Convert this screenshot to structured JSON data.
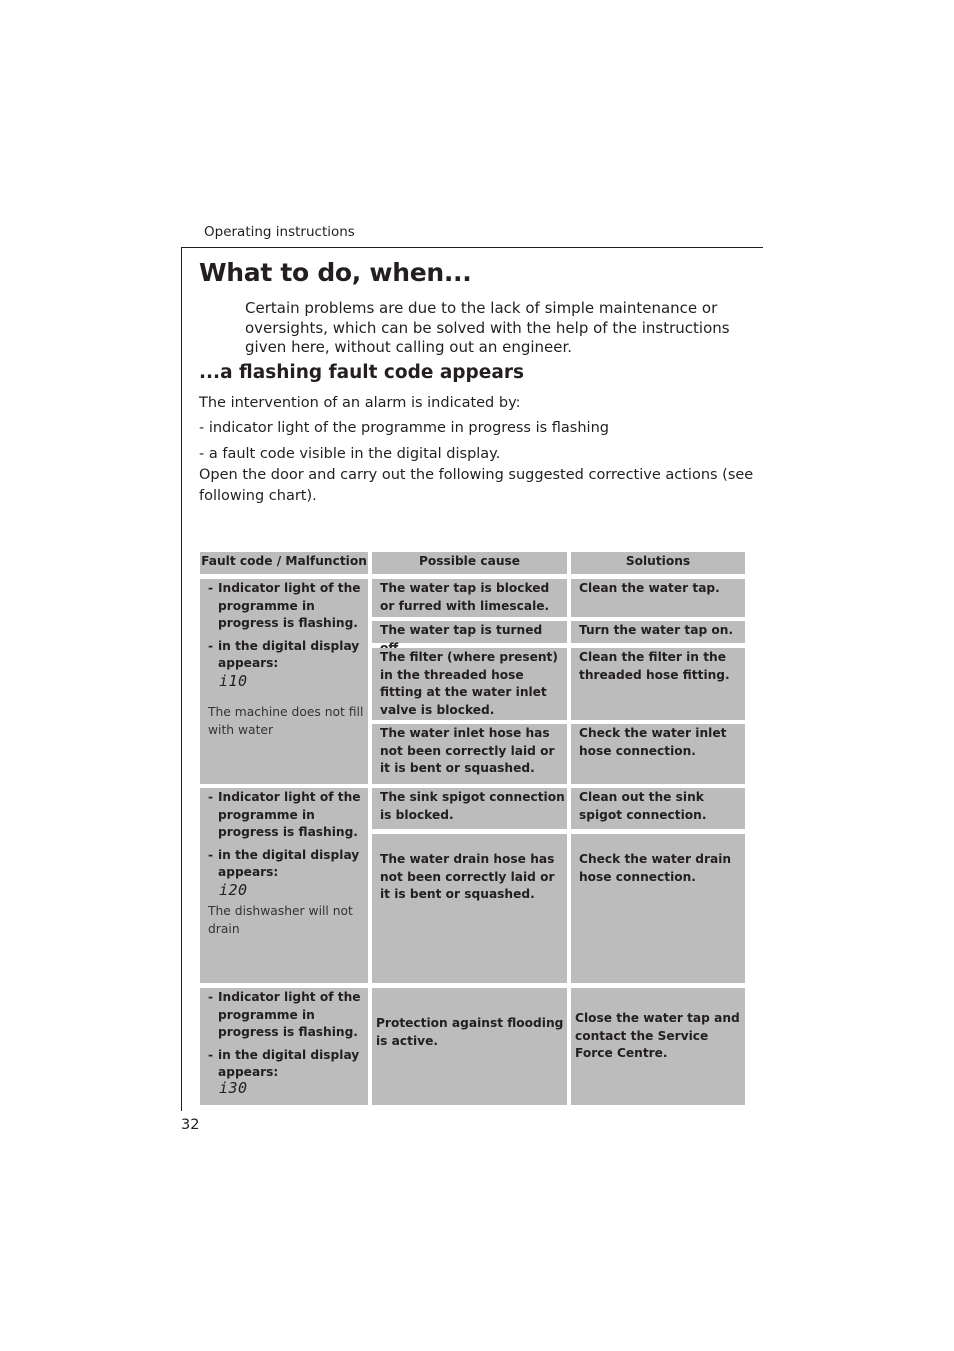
{
  "header": {
    "running_head": "Operating instructions"
  },
  "title": "What to do, when...",
  "intro": "Certain problems are due to the lack of simple maintenance or oversights, which can be solved with the help of the instructions given here, without calling out an engineer.",
  "section": {
    "title": "...a flashing fault code appears",
    "lines": [
      "The intervention of an alarm is indicated by:",
      "- indicator light of the programme in progress is flashing",
      "- a fault code visible in the digital display.",
      "Open the door and carry out the following suggested corrective actions (see following chart)."
    ]
  },
  "table": {
    "headers": [
      "Fault code / Malfunction",
      "Possible cause",
      "Solutions"
    ],
    "groups": [
      {
        "fault_items": [
          "Indicator light of the programme in progress is flashing.",
          "in the digital display appears:"
        ],
        "code": "i10",
        "note": "The machine does not fill with water",
        "rows": [
          {
            "cause": "The water tap is blocked or furred with limescale.",
            "solution": "Clean the water tap."
          },
          {
            "cause": "The water tap is turned off.",
            "solution": "Turn the water tap on."
          },
          {
            "cause": "The filter (where present) in the threaded hose fitting at the water inlet valve is blocked.",
            "solution": "Clean the filter in the threaded hose fitting."
          },
          {
            "cause": "The water inlet hose has not been correctly laid or it is bent or squashed.",
            "solution": "Check the water inlet hose connection."
          }
        ]
      },
      {
        "fault_items": [
          "Indicator light of the programme in progress is flashing.",
          "in the digital display appears:"
        ],
        "code": "i20",
        "note": "The dishwasher will not drain",
        "rows": [
          {
            "cause": "The sink spigot connection is blocked.",
            "solution": "Clean out the sink spigot connection."
          },
          {
            "cause": "The water drain hose has not been correctly laid or it is bent or squashed.",
            "solution": "Check the water drain hose connection."
          }
        ]
      },
      {
        "fault_items": [
          "Indicator light of the programme in progress is flashing.",
          "in the digital display appears:"
        ],
        "code": "i30",
        "note": "",
        "rows": [
          {
            "cause": "Protection against flooding is active.",
            "solution": "Close the water tap and contact the Service Force Centre."
          }
        ]
      }
    ]
  },
  "footer": {
    "page_number": "32"
  }
}
